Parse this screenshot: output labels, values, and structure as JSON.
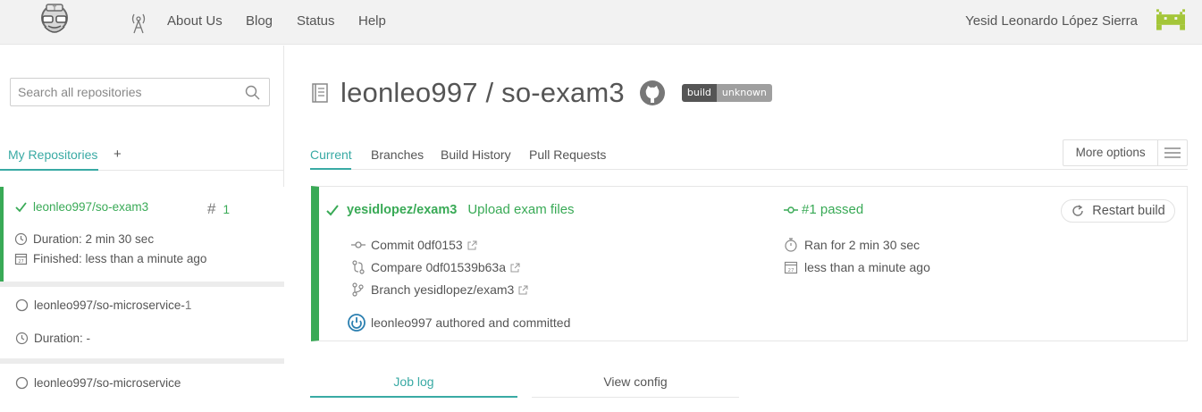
{
  "header": {
    "nav": [
      "About Us",
      "Blog",
      "Status",
      "Help"
    ],
    "user_name": "Yesid Leonardo López Sierra",
    "logo_icon": "travis-mascot-icon",
    "broadcast_icon": "broadcast-antenna-icon",
    "avatar_icon": "pixel-invader-avatar"
  },
  "sidebar": {
    "search_placeholder": "Search all repositories",
    "tab_my": "My Repositories",
    "tab_add": "+",
    "repos": [
      {
        "name": "leonleo997/so-exam3",
        "build_number": "1",
        "duration": "Duration: 2 min 30 sec",
        "finished": "Finished: less than a minute ago",
        "status": "passed"
      },
      {
        "name": "leonleo997/so-microservice-",
        "name_suffix": "1",
        "duration": "Duration: -",
        "status": "none"
      },
      {
        "name": "leonleo997/so-microservice",
        "status": "none"
      }
    ]
  },
  "main": {
    "title": "leonleo997 / so-exam3",
    "badge_left": "build",
    "badge_right": "unknown",
    "tabs": [
      "Current",
      "Branches",
      "Build History",
      "Pull Requests"
    ],
    "more_options": "More options",
    "build": {
      "branch": "yesidlopez/exam3",
      "message": "Upload exam files",
      "status_text": "#1 passed",
      "commit": "Commit 0df0153",
      "compare": "Compare 0df01539b63a",
      "branch_line": "Branch yesidlopez/exam3",
      "author_line": "leonleo997 authored and committed",
      "ran_for": "Ran for 2 min 30 sec",
      "finished": "less than a minute ago",
      "restart": "Restart build"
    },
    "job_tabs": [
      "Job log",
      "View config"
    ]
  },
  "colors": {
    "passed_green": "#39aa56",
    "accent_teal": "#39aaa4",
    "avatar_green": "#a4c639"
  }
}
